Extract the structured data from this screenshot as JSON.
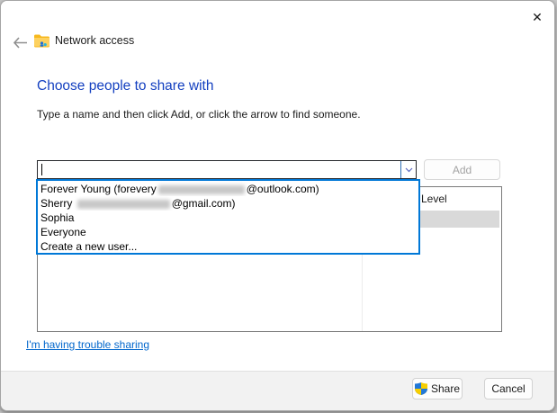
{
  "window": {
    "close_icon": "✕"
  },
  "nav": {
    "title": "Network access"
  },
  "main": {
    "heading": "Choose people to share with",
    "instruction": "Type a name and then click Add, or click the arrow to find someone."
  },
  "combobox": {
    "value": "",
    "add_label": "Add"
  },
  "dropdown": {
    "items": [
      {
        "prefix": "Forever Young (forevery",
        "redacted_width": 96,
        "suffix": "@outlook.com)"
      },
      {
        "prefix": "Sherry ",
        "redacted_width": 103,
        "suffix": "@gmail.com)"
      },
      {
        "prefix": "Sophia",
        "redacted_width": 0,
        "suffix": ""
      },
      {
        "prefix": "Everyone",
        "redacted_width": 0,
        "suffix": ""
      },
      {
        "prefix": "Create a new user...",
        "redacted_width": 0,
        "suffix": ""
      }
    ]
  },
  "listview": {
    "level_header": "Level"
  },
  "link": {
    "label": "I'm having trouble sharing"
  },
  "footer": {
    "share_label": "Share",
    "cancel_label": "Cancel"
  },
  "colors": {
    "accent_blue": "#0078d7",
    "heading_blue": "#1440c0",
    "link_blue": "#0066cc",
    "selected_row_gray": "#d9d9d9"
  }
}
